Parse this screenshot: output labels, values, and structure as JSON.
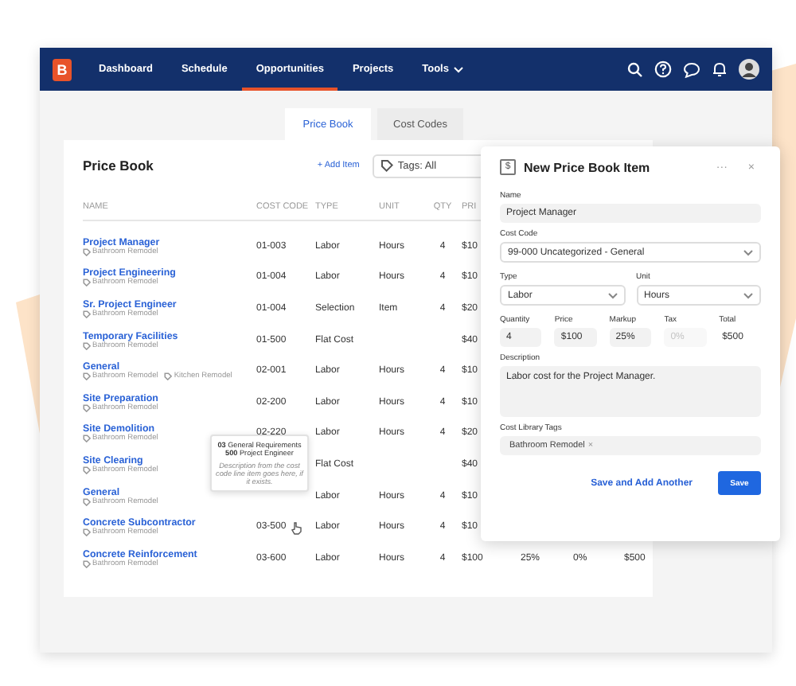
{
  "nav": {
    "logo": "B",
    "items": [
      {
        "label": "Dashboard",
        "selected": false,
        "dropdown": false
      },
      {
        "label": "Schedule",
        "selected": false,
        "dropdown": false
      },
      {
        "label": "Opportunities",
        "selected": true,
        "dropdown": false
      },
      {
        "label": "Projects",
        "selected": false,
        "dropdown": false
      },
      {
        "label": "Tools",
        "selected": false,
        "dropdown": true
      }
    ]
  },
  "tabs": [
    {
      "label": "Price Book",
      "selected": true
    },
    {
      "label": "Cost Codes",
      "selected": false
    }
  ],
  "price_book": {
    "title": "Price Book",
    "add_button": "+ Add Item",
    "tags_filter": "Tags: All",
    "columns": [
      "NAME",
      "COST CODE",
      "TYPE",
      "UNIT",
      "QTY",
      "PRI"
    ],
    "rows": [
      {
        "name": "Project Manager",
        "tags": [
          "Bathroom Remodel"
        ],
        "cost_code": "01-003",
        "type": "Labor",
        "unit": "Hours",
        "qty": "4",
        "price": "$10"
      },
      {
        "name": "Project Engineering",
        "tags": [
          "Bathroom Remodel"
        ],
        "cost_code": "01-004",
        "type": "Labor",
        "unit": "Hours",
        "qty": "4",
        "price": "$10"
      },
      {
        "name": "Sr. Project Engineer",
        "tags": [
          "Bathroom Remodel"
        ],
        "cost_code": "01-004",
        "type": "Selection",
        "unit": "Item",
        "qty": "4",
        "price": "$20"
      },
      {
        "name": "Temporary Facilities",
        "tags": [
          "Bathroom Remodel"
        ],
        "cost_code": "01-500",
        "type": "Flat Cost",
        "price": "$40"
      },
      {
        "name": "General",
        "tags": [
          "Bathroom Remodel",
          "Kitchen Remodel"
        ],
        "cost_code": "02-001",
        "type": "Labor",
        "unit": "Hours",
        "qty": "4",
        "price": "$10"
      },
      {
        "name": "Site Preparation",
        "tags": [
          "Bathroom Remodel"
        ],
        "cost_code": "02-200",
        "type": "Labor",
        "unit": "Hours",
        "qty": "4",
        "price": "$10"
      },
      {
        "name": "Site Demolition",
        "tags": [
          "Bathroom Remodel"
        ],
        "cost_code": "02-220",
        "type": "Labor",
        "unit": "Hours",
        "qty": "4",
        "price": "$20"
      },
      {
        "name": "Site Clearing",
        "tags": [
          "Bathroom Remodel"
        ],
        "type": "Flat Cost",
        "price": "$40"
      },
      {
        "name": "General",
        "tags": [
          "Bathroom Remodel"
        ],
        "type": "Labor",
        "unit": "Hours",
        "qty": "4",
        "price": "$10"
      },
      {
        "name": "Concrete Subcontractor",
        "tags": [
          "Bathroom Remodel"
        ],
        "cost_code": "03-500",
        "type": "Labor",
        "unit": "Hours",
        "qty": "4",
        "price": "$10"
      },
      {
        "name": "Concrete Reinforcement",
        "tags": [
          "Bathroom Remodel"
        ],
        "cost_code": "03-600",
        "type": "Labor",
        "unit": "Hours",
        "qty": "4",
        "price": "$100",
        "markup": "25%",
        "tax": "0%",
        "total": "$500"
      }
    ],
    "tooltip": {
      "lines": [
        "**03** General Requirements",
        "**500** Project Engineer"
      ],
      "description": "Description from the cost code line item goes here, if it exists."
    }
  },
  "panel": {
    "icon": "$",
    "title": "New Price Book Item",
    "more": "···",
    "close": "×",
    "name": {
      "label": "Name",
      "value": "Project Manager"
    },
    "cost_code": {
      "label": "Cost Code",
      "value": "99-000 Uncategorized - General"
    },
    "selects": [
      {
        "label": "Type",
        "value": "Labor"
      },
      {
        "label": "Unit",
        "value": "Hours"
      }
    ],
    "amounts": [
      {
        "label": "Quantity",
        "value": "4",
        "kind": "field",
        "disabled": false
      },
      {
        "label": "Price",
        "value": "$100",
        "kind": "field",
        "disabled": false
      },
      {
        "label": "Markup",
        "value": "25%",
        "kind": "field",
        "disabled": false
      },
      {
        "label": "Tax",
        "value": "0%",
        "kind": "field",
        "disabled": true
      },
      {
        "label": "Total",
        "value": "$500",
        "kind": "text"
      }
    ],
    "description": {
      "label": "Description",
      "value": "Labor cost for the Project Manager."
    },
    "tags": {
      "label": "Cost Library Tags",
      "items": [
        {
          "label": "Bathroom Remodel",
          "remove": "×"
        }
      ]
    },
    "secondary_button": "Save and Add Another",
    "primary_button": "Save"
  }
}
